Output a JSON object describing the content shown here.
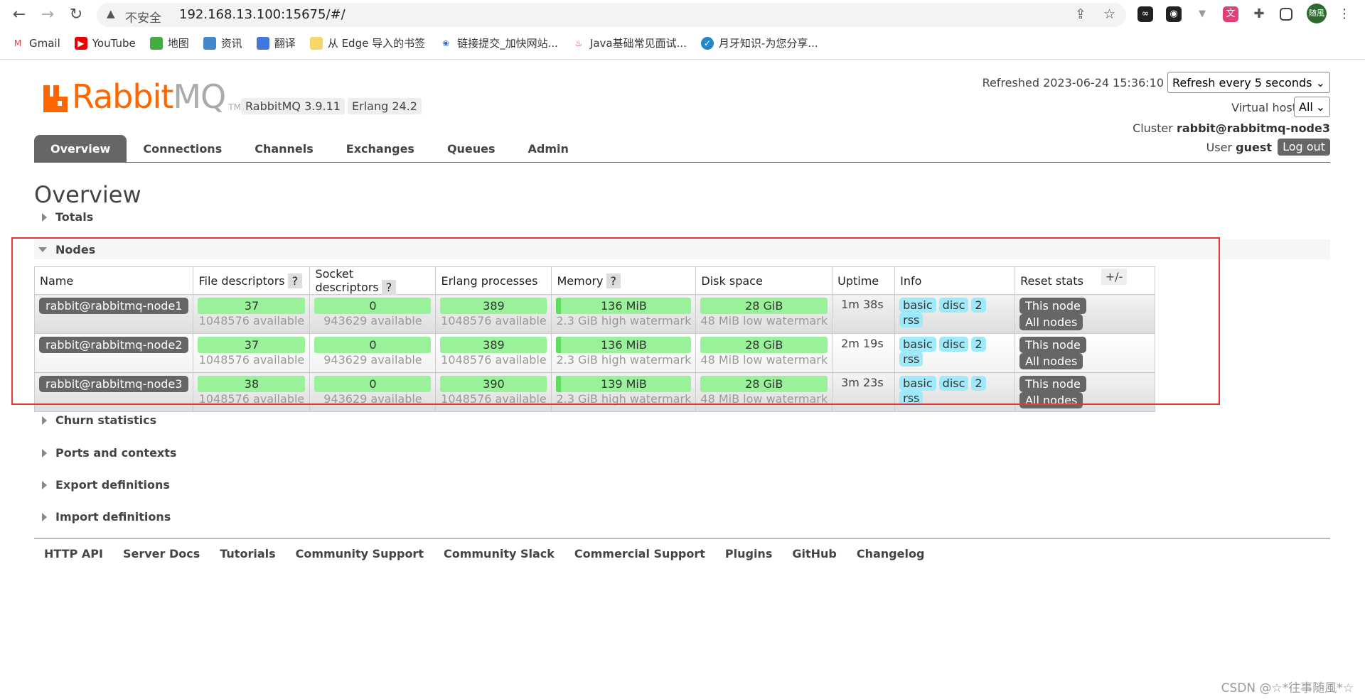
{
  "browser": {
    "insecure_label": "不安全",
    "url": "192.168.13.100:15675/#/",
    "profile": "随風",
    "bookmarks": [
      "Gmail",
      "YouTube",
      "地图",
      "资讯",
      "翻译",
      "从 Edge 导入的书签",
      "链接提交_加快网站...",
      "Java基础常见面试...",
      "月牙知识-为您分享..."
    ]
  },
  "header": {
    "logo": "RabbitMQ",
    "tm": "TM",
    "version": "RabbitMQ 3.9.11",
    "erlang": "Erlang 24.2",
    "refreshed": "Refreshed 2023-06-24 15:36:10",
    "refresh_select": "Refresh every 5 seconds",
    "vhost_label": "Virtual host",
    "vhost_value": "All",
    "cluster_label": "Cluster",
    "cluster_name": "rabbit@rabbitmq-node3",
    "user_label": "User",
    "user_name": "guest",
    "logout": "Log out"
  },
  "tabs": [
    "Overview",
    "Connections",
    "Channels",
    "Exchanges",
    "Queues",
    "Admin"
  ],
  "active_tab": "Overview",
  "page_title": "Overview",
  "sections": {
    "totals": "Totals",
    "nodes": "Nodes",
    "churn": "Churn statistics",
    "ports": "Ports and contexts",
    "export": "Export definitions",
    "import": "Import definitions"
  },
  "nodes_table": {
    "columns": [
      "Name",
      "File descriptors",
      "Socket descriptors",
      "Erlang processes",
      "Memory",
      "Disk space",
      "Uptime",
      "Info",
      "Reset stats"
    ],
    "help": "?",
    "plus_minus": "+/-",
    "rows": [
      {
        "name": "rabbit@rabbitmq-node1",
        "fd": "37",
        "fd_avail": "1048576 available",
        "sd": "0",
        "sd_avail": "943629 available",
        "proc": "389",
        "proc_avail": "1048576 available",
        "mem": "136 MiB",
        "mem_sub": "2.3 GiB high watermark",
        "disk": "28 GiB",
        "disk_sub": "48 MiB low watermark",
        "uptime": "1m 38s",
        "info": [
          "basic",
          "disc",
          "2",
          "rss"
        ],
        "reset": [
          "This node",
          "All nodes"
        ]
      },
      {
        "name": "rabbit@rabbitmq-node2",
        "fd": "37",
        "fd_avail": "1048576 available",
        "sd": "0",
        "sd_avail": "943629 available",
        "proc": "389",
        "proc_avail": "1048576 available",
        "mem": "136 MiB",
        "mem_sub": "2.3 GiB high watermark",
        "disk": "28 GiB",
        "disk_sub": "48 MiB low watermark",
        "uptime": "2m 19s",
        "info": [
          "basic",
          "disc",
          "2",
          "rss"
        ],
        "reset": [
          "This node",
          "All nodes"
        ]
      },
      {
        "name": "rabbit@rabbitmq-node3",
        "fd": "38",
        "fd_avail": "1048576 available",
        "sd": "0",
        "sd_avail": "943629 available",
        "proc": "390",
        "proc_avail": "1048576 available",
        "mem": "139 MiB",
        "mem_sub": "2.3 GiB high watermark",
        "disk": "28 GiB",
        "disk_sub": "48 MiB low watermark",
        "uptime": "3m 23s",
        "info": [
          "basic",
          "disc",
          "2",
          "rss"
        ],
        "reset": [
          "This node",
          "All nodes"
        ]
      }
    ]
  },
  "footer": [
    "HTTP API",
    "Server Docs",
    "Tutorials",
    "Community Support",
    "Community Slack",
    "Commercial Support",
    "Plugins",
    "GitHub",
    "Changelog"
  ],
  "watermark": "CSDN @☆*往事随風*☆",
  "colors": {
    "brand": "#ff6600",
    "bar_green": "#99f199",
    "pill_blue": "#9ee9fa",
    "highlight_box": "#ee3333"
  }
}
